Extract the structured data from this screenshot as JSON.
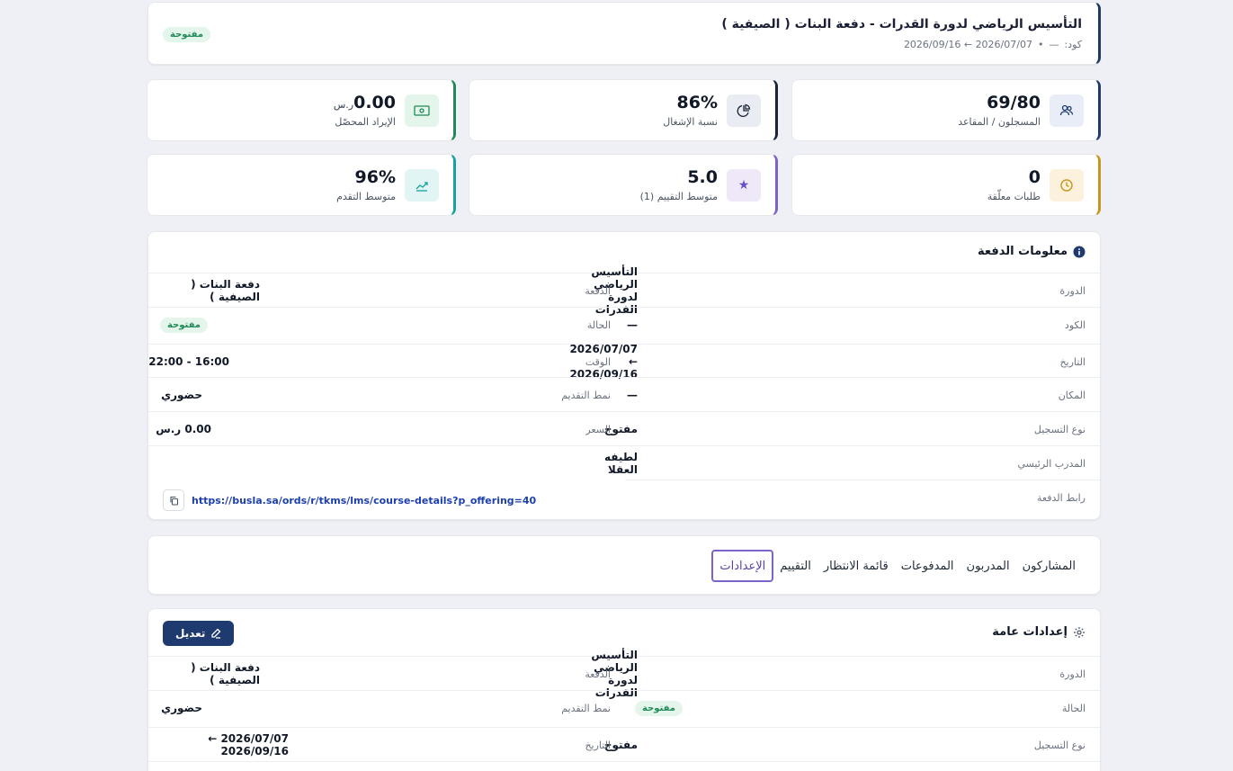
{
  "header": {
    "title": "التأسيس الرياضي لدورة القدرات - دفعة البنات ( الصيفية )",
    "code_label": "كود:",
    "code_value": "—",
    "dot": "•",
    "date_range": "2026/07/07 ← 2026/09/16",
    "status": "مفتوحة"
  },
  "stats": {
    "enrolled": {
      "value": "69/80",
      "label": "المسجلون / المقاعد",
      "icon": "users-icon"
    },
    "occupancy": {
      "value": "86%",
      "label": "نسبة الإشغال",
      "icon": "pie-chart-icon"
    },
    "revenue": {
      "value": "0.00",
      "unit": "ر.س",
      "label": "الإيراد المحصّل",
      "icon": "money-icon"
    },
    "pending": {
      "value": "0",
      "label": "طلبات معلّقة",
      "icon": "clock-icon"
    },
    "rating": {
      "value": "5.0",
      "label": "متوسط التقييم (1)",
      "icon": "star-icon"
    },
    "progress": {
      "value": "96%",
      "label": "متوسط التقدم",
      "icon": "trend-icon"
    }
  },
  "info": {
    "title": "معلومات الدفعة",
    "course_label": "الدورة",
    "course_value": "التأسيس الرياضي لدورة القدرات",
    "batch_label": "الدفعة",
    "batch_value": "دفعة البنات ( الصيفية )",
    "code_label": "الكود",
    "code_value": "—",
    "status_label": "الحالة",
    "status_value": "مفتوحة",
    "date_label": "التاريخ",
    "date_value": "2026/07/07 ← 2026/09/16",
    "time_label": "الوقت",
    "time_value": "16:00 - 22:00",
    "place_label": "المكان",
    "place_value": "—",
    "mode_label": "نمط التقديم",
    "mode_value": "حضوري",
    "regtype_label": "نوع التسجيل",
    "regtype_value": "مفتوح",
    "price_label": "السعر",
    "price_value": "0.00 ر.س",
    "trainer_label": "المدرب الرئيسي",
    "trainer_value": "لطيفه العقلا",
    "link_label": "رابط الدفعة",
    "link_value": "https://busla.sa/ords/r/tkms/lms/course-details?p_offering=40"
  },
  "tabs": [
    "المشاركون",
    "المدربون",
    "المدفوعات",
    "قائمة الانتظار",
    "التقييم",
    "الإعدادات"
  ],
  "active_tab": "الإعدادات",
  "settings": {
    "title": "إعدادات عامة",
    "edit_label": "تعديل",
    "course_label": "الدورة",
    "course_value": "التأسيس الرياضي لدورة القدرات",
    "batch_label": "الدفعة",
    "batch_value": "دفعة البنات ( الصيفية )",
    "status_label": "الحالة",
    "status_value": "مفتوحة",
    "mode_label": "نمط التقديم",
    "mode_value": "حضوري",
    "regtype_label": "نوع التسجيل",
    "regtype_value": "مفتوح",
    "date_label": "التاريخ",
    "date_value": "2026/07/07 ← 2026/09/16"
  }
}
